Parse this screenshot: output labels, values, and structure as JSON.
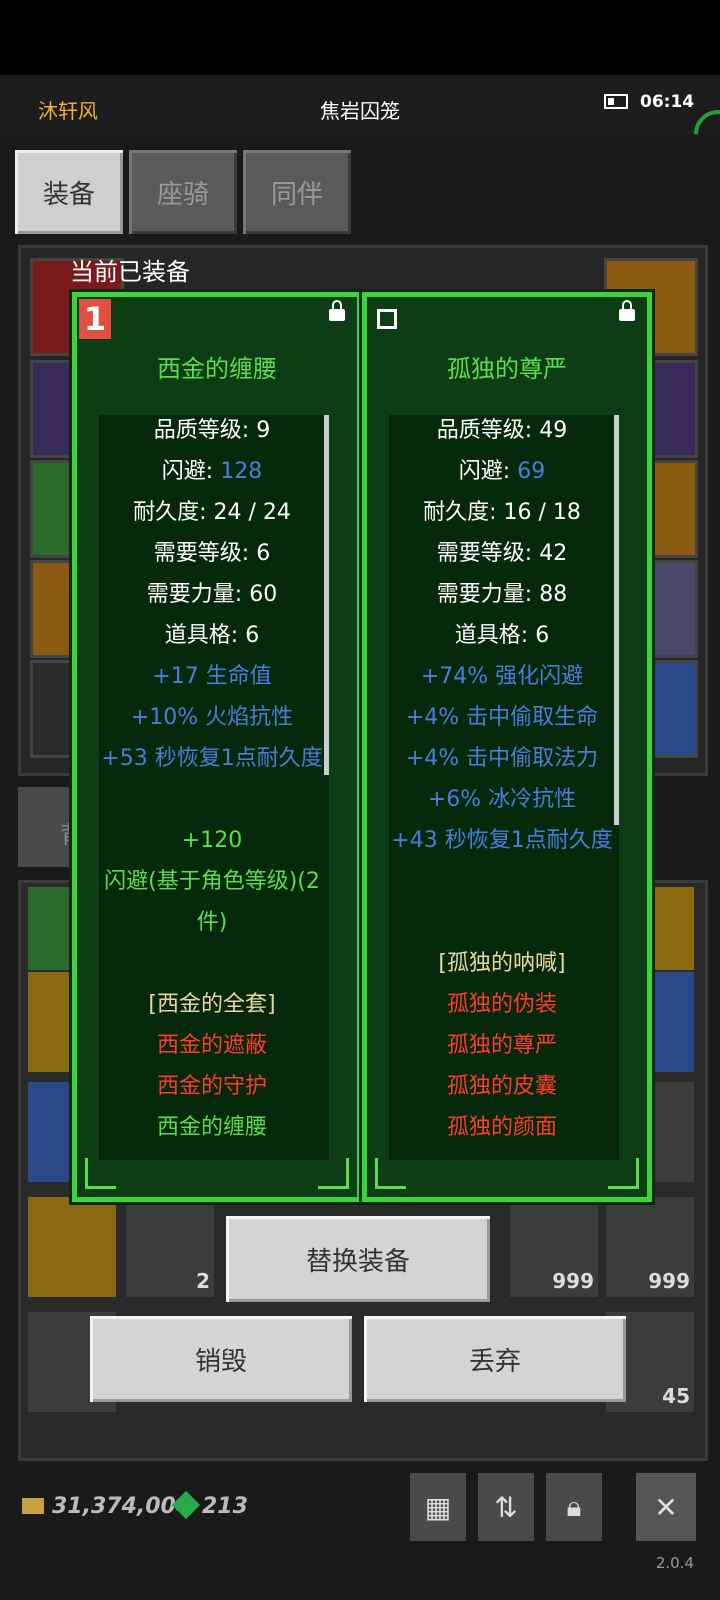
{
  "status": {
    "player_name": "沐轩风",
    "location": "焦岩囚笼",
    "time": "06:14"
  },
  "tabs": [
    {
      "label": "装备",
      "active": true
    },
    {
      "label": "座骑",
      "active": false
    },
    {
      "label": "同伴",
      "active": false
    }
  ],
  "equipped_label": "当前已装备",
  "backpack_tab_label": "背",
  "item_left": {
    "badge": "1",
    "name": "西金的缠腰",
    "stats": [
      {
        "text": "品质等级: 9",
        "color": "white"
      },
      {
        "prefix": "闪避: ",
        "value": "128",
        "color": "mixed"
      },
      {
        "text": "耐久度: 24 / 24",
        "color": "white"
      },
      {
        "text": "需要等级: 6",
        "color": "white"
      },
      {
        "text": "需要力量: 60",
        "color": "white"
      },
      {
        "text": "道具格: 6",
        "color": "white"
      },
      {
        "text": "+17 生命值",
        "color": "blue"
      },
      {
        "text": "+10% 火焰抗性",
        "color": "blue"
      },
      {
        "text": "+53 秒恢复1点耐久度",
        "color": "blue"
      },
      {
        "text": "",
        "color": "white"
      },
      {
        "text": "+120",
        "color": "green"
      },
      {
        "text": "闪避(基于角色等级)(2",
        "color": "green"
      },
      {
        "text": "件)",
        "color": "green"
      },
      {
        "text": "",
        "color": "white"
      },
      {
        "text": "[西金的全套]",
        "color": "gold"
      },
      {
        "text": "西金的遮蔽",
        "color": "red"
      },
      {
        "text": "西金的守护",
        "color": "red"
      },
      {
        "text": "西金的缠腰",
        "color": "green"
      }
    ]
  },
  "item_right": {
    "name": "孤独的尊严",
    "stats": [
      {
        "text": "品质等级: 49",
        "color": "white"
      },
      {
        "prefix": "闪避: ",
        "value": "69",
        "color": "mixed"
      },
      {
        "text": "耐久度: 16 / 18",
        "color": "white"
      },
      {
        "text": "需要等级: 42",
        "color": "white"
      },
      {
        "text": "需要力量: 88",
        "color": "white"
      },
      {
        "text": "道具格: 6",
        "color": "white"
      },
      {
        "text": "+74% 强化闪避",
        "color": "blue"
      },
      {
        "text": "+4% 击中偷取生命",
        "color": "blue"
      },
      {
        "text": "+4% 击中偷取法力",
        "color": "blue"
      },
      {
        "text": "+6% 冰冷抗性",
        "color": "blue"
      },
      {
        "text": "+43 秒恢复1点耐久度",
        "color": "blue"
      },
      {
        "text": "",
        "color": "white"
      },
      {
        "text": "",
        "color": "white"
      },
      {
        "text": "[孤独的呐喊]",
        "color": "gold"
      },
      {
        "text": "孤独的伪装",
        "color": "red"
      },
      {
        "text": "孤独的尊严",
        "color": "red"
      },
      {
        "text": "孤独的皮囊",
        "color": "red"
      },
      {
        "text": "孤独的颜面",
        "color": "red"
      }
    ]
  },
  "buttons": {
    "replace": "替换装备",
    "destroy": "销毁",
    "discard": "丢弃"
  },
  "inventory_counts": [
    "2",
    "999",
    "999",
    "45"
  ],
  "currency": {
    "gold": "31,374,004",
    "gems": "213"
  },
  "version": "2.0.4"
}
